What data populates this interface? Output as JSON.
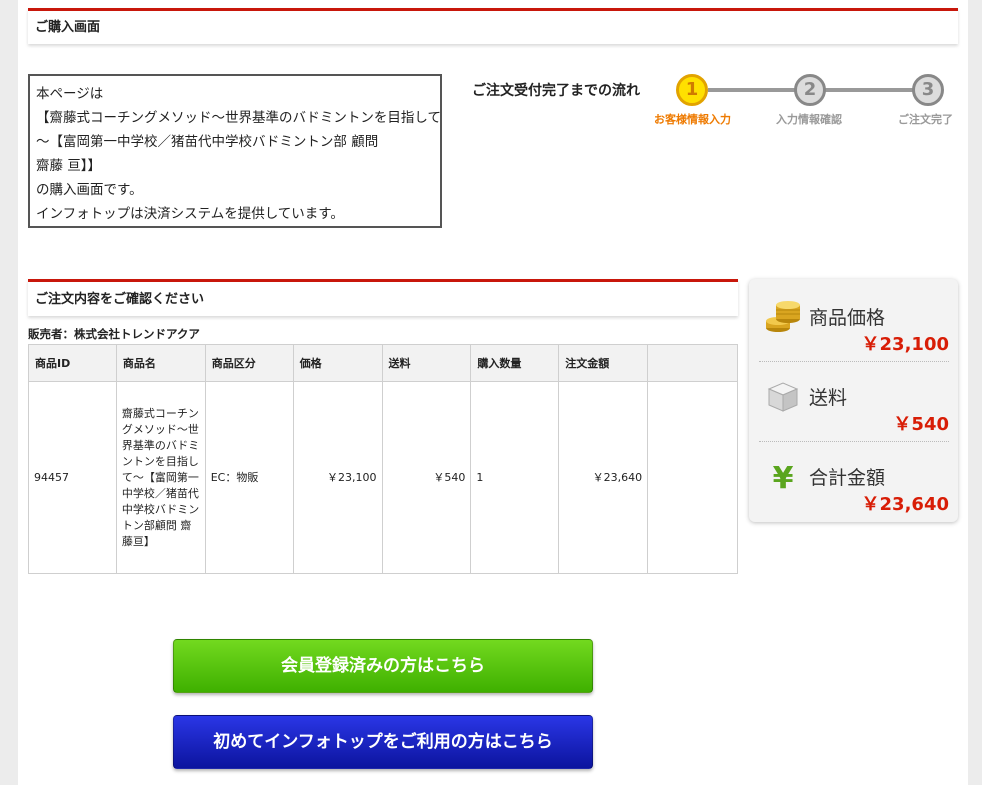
{
  "header": {
    "title": "ご購入画面"
  },
  "intro": {
    "lines": [
      "本ページは",
      "【齋藤式コーチングメソッド〜世界基準のバドミントンを目指して",
      "〜【富岡第一中学校／猪苗代中学校バドミントン部 顧問",
      "齋藤 亘】】",
      "の購入画面です。",
      "インフォトップは決済システムを提供しています。"
    ]
  },
  "steps": {
    "title": "ご注文受付完了までの流れ",
    "items": [
      {
        "number": "1",
        "label": "お客様情報入力"
      },
      {
        "number": "2",
        "label": "入力情報確認"
      },
      {
        "number": "3",
        "label": "ご注文完了"
      }
    ],
    "active_index": 0
  },
  "confirm": {
    "title": "ご注文内容をご確認ください"
  },
  "seller": {
    "label": "販売者：株式会社トレンドアクア"
  },
  "table": {
    "headers": [
      "商品ID",
      "商品名",
      "商品区分",
      "価格",
      "送料",
      "購入数量",
      "注文金額",
      ""
    ],
    "rows": [
      {
        "id": "94457",
        "name": "齋藤式コーチングメソッド〜世界基準のバドミントンを目指して〜【富岡第一中学校／猪苗代中学校バドミントン部顧問 齋藤亘】",
        "category": "EC：物販",
        "price": "￥23,100",
        "shipping": "￥540",
        "quantity": "1",
        "total": "￥23,640",
        "extra": ""
      }
    ]
  },
  "summary": {
    "price": {
      "label": "商品価格",
      "value": "￥23,100",
      "icon": "gold-coins-icon"
    },
    "shipping": {
      "label": "送料",
      "value": "￥540",
      "icon": "box-icon"
    },
    "total": {
      "label": "合計金額",
      "value": "￥23,640",
      "icon": "yen-icon"
    }
  },
  "buttons": {
    "member": "会員登録済みの方はこちら",
    "first_time": "初めてインフォトップをご利用の方はこちら"
  },
  "colors": {
    "accent_red": "#c8170b",
    "price_red": "#d81d06",
    "step_active": "#ffe000",
    "button_green": "#3fb000",
    "button_blue": "#0c149e"
  }
}
